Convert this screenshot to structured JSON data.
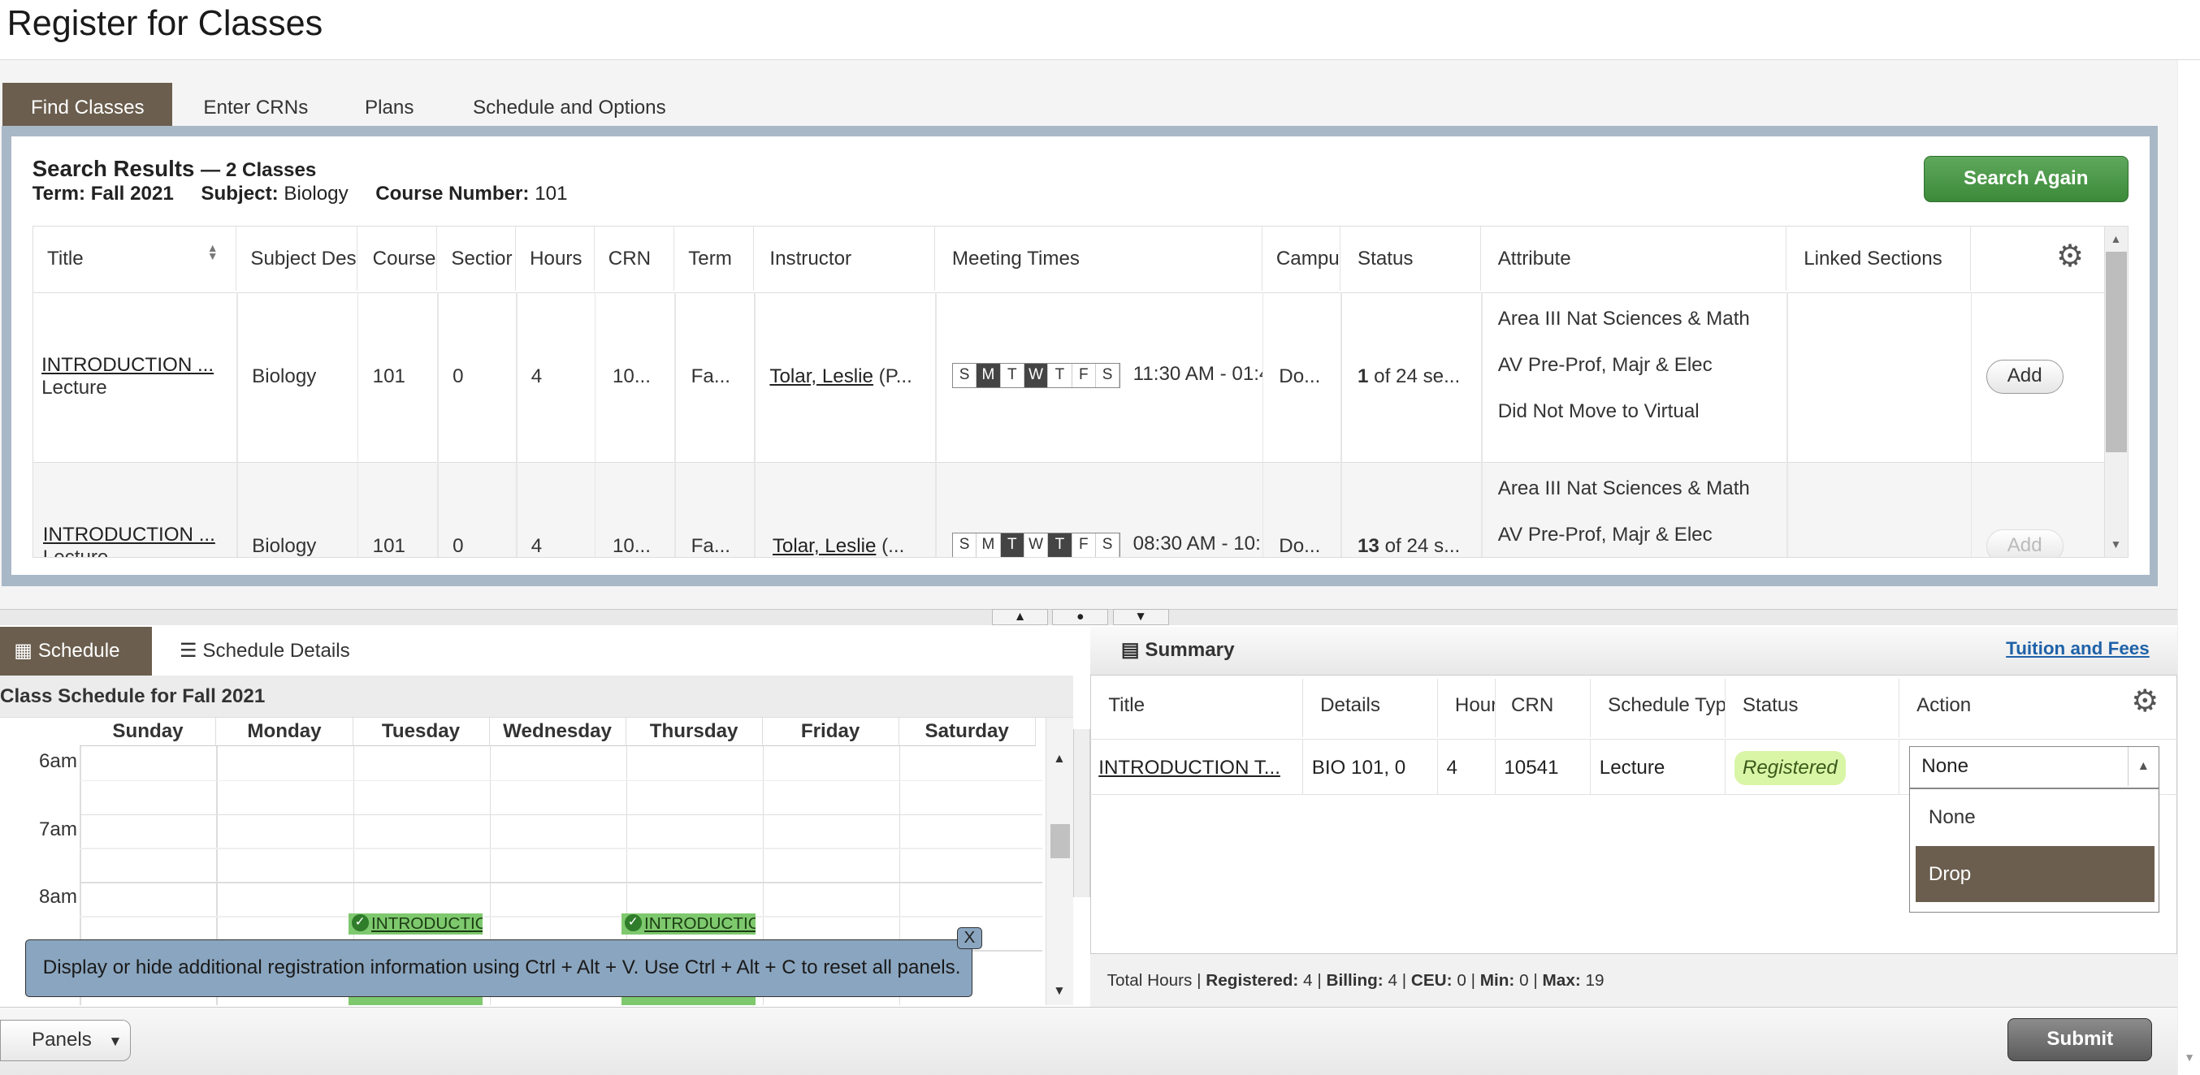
{
  "page": {
    "title": "Register for Classes"
  },
  "tabs": [
    {
      "label": "Find Classes"
    },
    {
      "label": "Enter CRNs"
    },
    {
      "label": "Plans"
    },
    {
      "label": "Schedule and Options"
    }
  ],
  "search": {
    "heading": "Search Results",
    "count": "— 2 Classes",
    "term_label": "Term:",
    "term": "Fall 2021",
    "subject_label": "Subject:",
    "subject": "Biology",
    "course_label": "Course Number:",
    "course": "101",
    "search_again": "Search Again"
  },
  "results": {
    "columns": [
      "Title",
      "Subject Des",
      "Course",
      "Sectior",
      "Hours",
      "CRN",
      "Term",
      "Instructor",
      "Meeting Times",
      "Campu",
      "Status",
      "Attribute",
      "Linked Sections"
    ],
    "rows": [
      {
        "title": "INTRODUCTION ...",
        "type": "Lecture",
        "subject": "Biology",
        "course": "101",
        "section": "0",
        "hours": "4",
        "crn": "10...",
        "term": "Fa...",
        "instructor": "Tolar, Leslie",
        "instructor_extra": "(P...",
        "days": [
          "S",
          "M",
          "T",
          "W",
          "T",
          "F",
          "S"
        ],
        "active_days": [
          1,
          3
        ],
        "time": "11:30 AM - 01:4",
        "campus": "Do...",
        "status_num": "1",
        "status_text": " of 24 se...",
        "attributes": [
          "Area III Nat Sciences & Math",
          "AV Pre-Prof, Majr & Elec",
          "Did Not Move to Virtual"
        ],
        "action": "Add"
      },
      {
        "title": "INTRODUCTION ...",
        "type": "Lecture",
        "subject": "Biology",
        "course": "101",
        "section": "0",
        "hours": "4",
        "crn": "10...",
        "term": "Fa...",
        "instructor": "Tolar, Leslie",
        "instructor_extra": "(...",
        "days": [
          "S",
          "M",
          "T",
          "W",
          "T",
          "F",
          "S"
        ],
        "active_days": [
          2,
          4
        ],
        "time": "08:30 AM - 10:",
        "campus": "Do...",
        "status_num": "13",
        "status_text": " of 24 s...",
        "attributes": [
          "Area III Nat Sciences & Math",
          "AV Pre-Prof, Majr & Elec"
        ],
        "action": "Add"
      }
    ]
  },
  "schedule": {
    "tab_schedule": "Schedule",
    "tab_details": "Schedule Details",
    "title": "Class Schedule for Fall 2021",
    "days": [
      "Sunday",
      "Monday",
      "Tuesday",
      "Wednesday",
      "Thursday",
      "Friday",
      "Saturday"
    ],
    "hours": [
      "6am",
      "7am",
      "8am"
    ],
    "events": [
      {
        "label": "INTRODUCTIO",
        "day": 2
      },
      {
        "label": "INTRODUCTIO",
        "day": 4
      }
    ]
  },
  "tooltip": {
    "text": "Display or hide additional registration information using Ctrl + Alt + V. Use Ctrl + Alt + C to reset all panels.",
    "close": "X"
  },
  "summary": {
    "title": "Summary",
    "link": "Tuition and Fees",
    "columns": [
      "Title",
      "Details",
      "Hour",
      "CRN",
      "Schedule Typ",
      "Status",
      "Action"
    ],
    "row": {
      "title": "INTRODUCTION T...",
      "details": "BIO 101, 0",
      "hours": "4",
      "crn": "10541",
      "schedule_type": "Lecture",
      "status": "Registered",
      "action": "None"
    },
    "options": [
      "None",
      "Drop"
    ],
    "totals": {
      "label": "Total Hours |",
      "registered_label": "Registered:",
      "registered": "4",
      "billing_label": "Billing:",
      "billing": "4",
      "ceu_label": "CEU:",
      "ceu": "0",
      "min_label": "Min:",
      "min": "0",
      "max_label": "Max:",
      "max": "19"
    }
  },
  "footer": {
    "panels": "Panels",
    "submit": "Submit"
  },
  "icons": {
    "gear": "gear-icon",
    "calendar": "calendar-icon",
    "list": "list-icon",
    "summary": "summary-icon"
  }
}
